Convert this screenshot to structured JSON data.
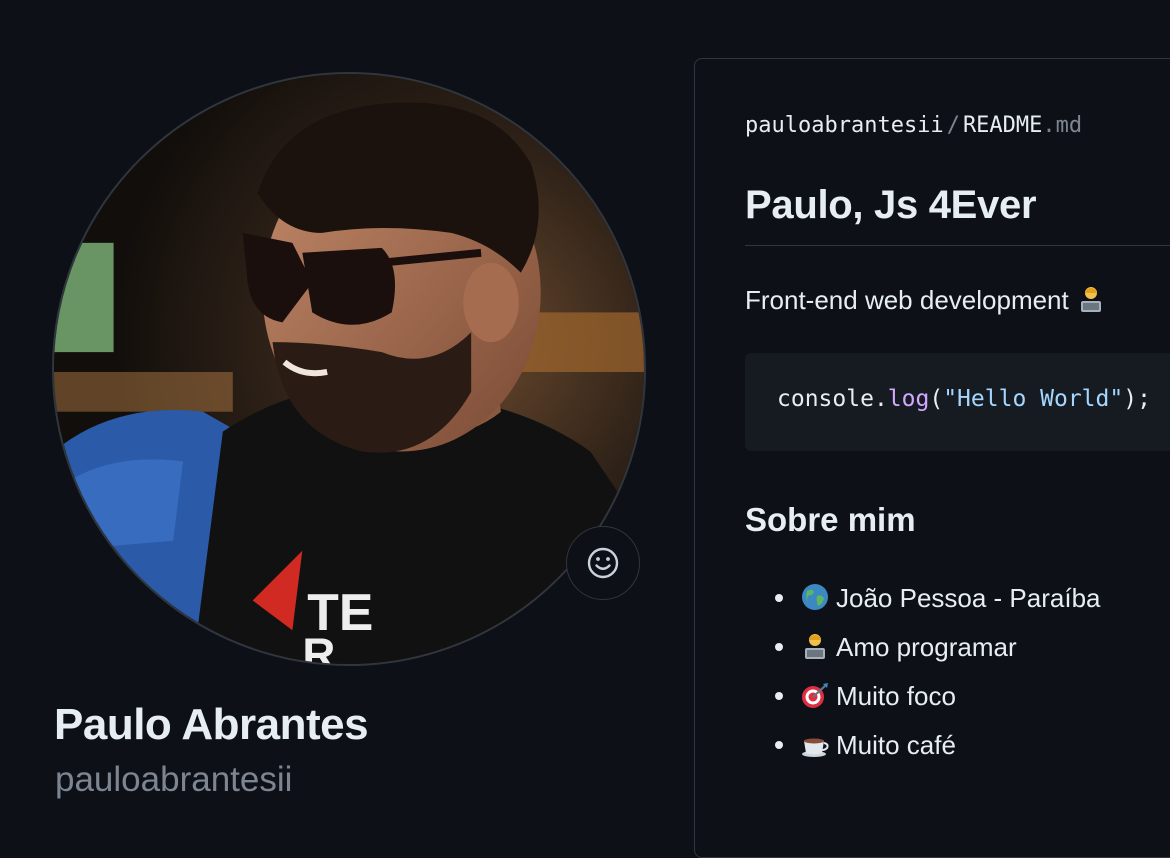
{
  "profile": {
    "name": "Paulo Abrantes",
    "login": "paulo­abrantesii",
    "avatar_icon": "profile-photo",
    "status_icon": "smiley-icon"
  },
  "readme": {
    "path_user": "pauloabrantesii",
    "path_separator": "/",
    "path_file": "README",
    "path_ext": ".md",
    "title": "Paulo, Js 4Ever",
    "tagline": "Front-end web development",
    "tagline_emoji": "technologist-emoji",
    "code": {
      "object": "console",
      "dot": ".",
      "method": "log",
      "open": "(",
      "string": "\"Hello World\"",
      "close": ");"
    },
    "about_heading": "Sobre mim",
    "about_items": [
      {
        "emoji": "globe-emoji",
        "text": "João Pessoa - Paraíba"
      },
      {
        "emoji": "technologist-emoji",
        "text": "Amo programar"
      },
      {
        "emoji": "direct-hit-emoji",
        "text": "Muito foco"
      },
      {
        "emoji": "hot-beverage-emoji",
        "text": "Muito café"
      }
    ]
  },
  "colors": {
    "background": "#0d1117",
    "border": "#30363d",
    "text": "#e6edf3",
    "muted": "#7d8590",
    "code_bg": "#161b22",
    "code_fn": "#d2a8ff",
    "code_str": "#a5d6ff"
  }
}
